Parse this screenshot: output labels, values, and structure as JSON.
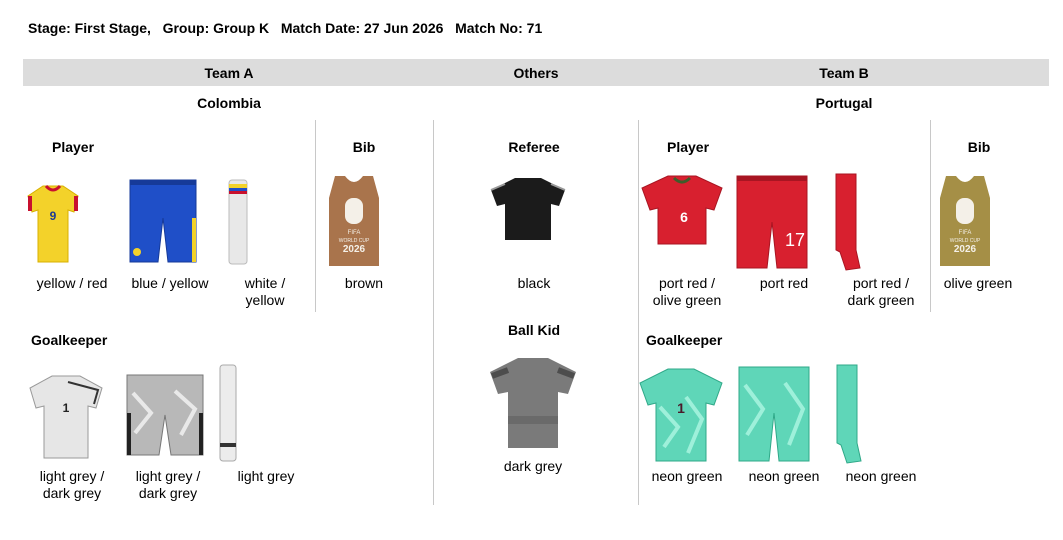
{
  "header": {
    "stage": "Stage: First Stage,",
    "group": "Group: Group K",
    "date": "Match Date: 27 Jun 2026",
    "match": "Match No: 71"
  },
  "columns": {
    "team_a": "Team A",
    "others": "Others",
    "team_b": "Team B"
  },
  "team_a": {
    "name": "Colombia",
    "player_title": "Player",
    "bib_title": "Bib",
    "gk_title": "Goalkeeper",
    "player": {
      "shirt": "yellow / red",
      "shorts": "blue / yellow",
      "socks_1": "white /",
      "socks_2": "yellow",
      "shirt_number": "9"
    },
    "bib": {
      "label": "brown",
      "text": "FIFA",
      "wc": "WORLD CUP",
      "year": "2026"
    },
    "gk": {
      "shirt_1": "light grey /",
      "shirt_2": "dark grey",
      "shorts_1": "light grey /",
      "shorts_2": "dark grey",
      "socks": "light grey",
      "shirt_number": "1"
    }
  },
  "others": {
    "referee_title": "Referee",
    "referee": "black",
    "ballkid_title": "Ball Kid",
    "ballkid": "dark grey"
  },
  "team_b": {
    "name": "Portugal",
    "player_title": "Player",
    "bib_title": "Bib",
    "gk_title": "Goalkeeper",
    "player": {
      "shirt_1": "port red /",
      "shirt_2": "olive green",
      "shorts": "port red",
      "socks_1": "port red /",
      "socks_2": "dark green",
      "shirt_number": "6",
      "shorts_number": "17"
    },
    "bib": {
      "label": "olive green",
      "text": "FIFA",
      "wc": "WORLD CUP",
      "year": "2026"
    },
    "gk": {
      "shirt": "neon green",
      "shorts": "neon green",
      "socks": "neon green",
      "shirt_number": "1"
    }
  },
  "colors": {
    "bar": "#dcdcdc",
    "col_yellow": "#f3d22a",
    "col_blue": "#1f4fc8",
    "col_brown": "#a9744c",
    "referee": "#1b1b1b",
    "ballkid": "#7a7a7a",
    "port_red": "#d8202f",
    "olive": "#a58f46",
    "neon": "#5fd6b8",
    "light_grey": "#e6e6e6"
  }
}
